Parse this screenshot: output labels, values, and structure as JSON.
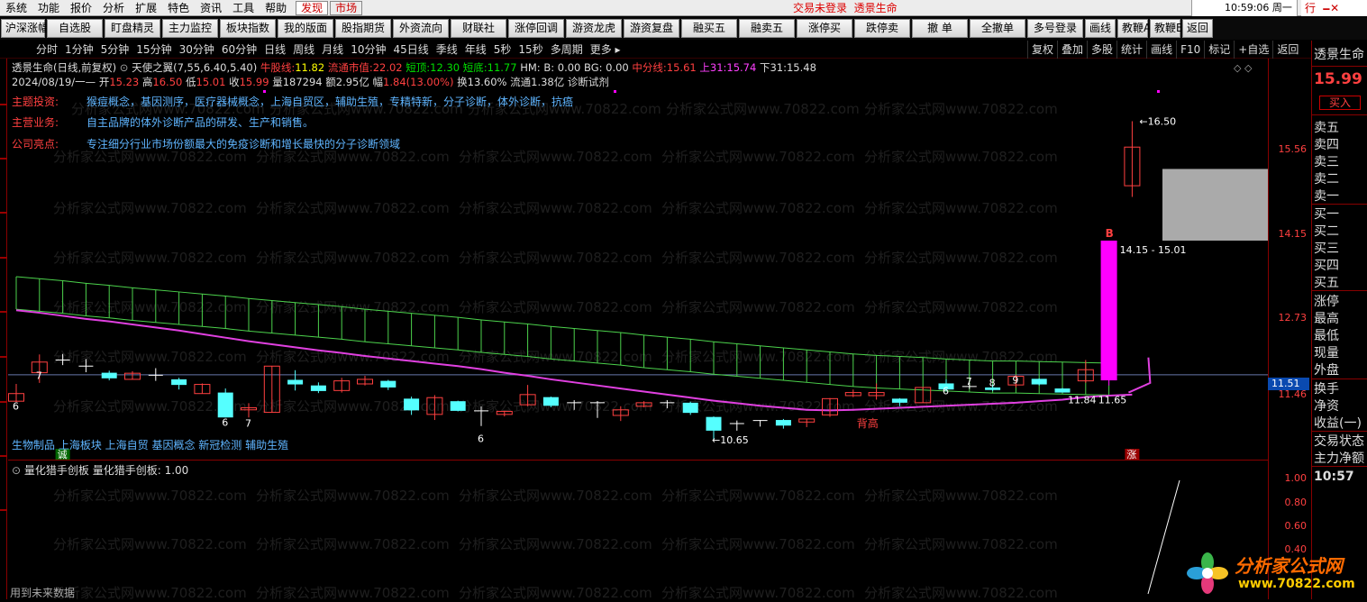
{
  "menubar": {
    "items": [
      "系统",
      "功能",
      "报价",
      "分析",
      "扩展",
      "特色",
      "资讯",
      "工具",
      "帮助"
    ],
    "tab_active": "发现",
    "tab_market": "市场",
    "login_text": "交易未登录",
    "login_stock": "透景生命",
    "clock": "10:59:06 周一",
    "trade": "行"
  },
  "toolbar": {
    "buttons": [
      "沪深涨幅",
      "自选股",
      "盯盘精灵",
      "主力监控",
      "板块指数",
      "我的版面",
      "股指期货",
      "外资流向",
      "财联社",
      "涨停回调",
      "游资龙虎",
      "游资复盘",
      "融买五",
      "融卖五",
      "涨停买",
      "跌停卖",
      "撤 单",
      "全撤单",
      "多号登录",
      "画线",
      "教鞭A",
      "教鞭B",
      "返回"
    ]
  },
  "periodbar": {
    "periods": [
      "分时",
      "1分钟",
      "5分钟",
      "15分钟",
      "30分钟",
      "60分钟",
      "日线",
      "周线",
      "月线",
      "10分钟",
      "45日线",
      "季线",
      "年线",
      "5秒",
      "15秒",
      "多周期",
      "更多"
    ],
    "right_tools": [
      "复权",
      "叠加",
      "多股",
      "统计",
      "画线",
      "F10",
      "标记",
      "+自选",
      "返回"
    ]
  },
  "info": {
    "stock": "透景生命(日线,前复权)",
    "indicator": "天使之翼(7,55,6.40,5.40)",
    "niu_label": "牛股线:",
    "niu_val": "11.82",
    "liutong_label": "流通市值:",
    "liutong_val": "22.02",
    "duanding_label": "短顶:",
    "duanding_val": "12.30",
    "duandi_label": "短底:",
    "duandi_val": "11.77",
    "hm": "HM: B: 0.00",
    "bg": "BG: 0.00",
    "zhongfen_label": "中分线:",
    "zhongfen_val": "15.61",
    "shang_label": "上31:",
    "shang_val": "15.74",
    "xia": "下31:15.48",
    "date": "2024/08/19/一",
    "open_label": "开",
    "open_val": "15.23",
    "high_label": "高",
    "high_val": "16.50",
    "low_label": "低",
    "low_val": "15.01",
    "close_label": "收",
    "close_val": "15.99",
    "vol_label": "量",
    "vol_val": "187294",
    "amt_label": "额",
    "amt_val": "2.95亿",
    "chg_label": "幅",
    "chg_val": "1.84(13.00%)",
    "turn_label": "换",
    "turn_val": "13.60%",
    "flow_label": "流通",
    "flow_val": "1.38亿",
    "tag": "诊断试剂"
  },
  "profile": [
    {
      "key": "主题投资:",
      "value": "猴痘概念，基因测序，医疗器械概念，上海自贸区，辅助生殖，专精特新，分子诊断，体外诊断，抗癌"
    },
    {
      "key": "主营业务:",
      "value": "自主品牌的体外诊断产品的研发、生产和销售。"
    },
    {
      "key": "公司亮点:",
      "value": "专注细分行业市场份额最大的免疫诊断和增长最快的分子诊断领域"
    }
  ],
  "concepts": "生物制品 上海板块 上海自贸 基因概念 新冠检测 辅助生殖",
  "watermark": "分析家公式网www.70822.com",
  "chart_data": {
    "type": "candlestick",
    "ylim": [
      10.0,
      17.2
    ],
    "candles": [
      {
        "o": 10.99,
        "c": 11.14,
        "h": 11.33,
        "l": 10.97
      },
      {
        "o": 11.55,
        "c": 11.76,
        "h": 11.91,
        "l": 11.35
      },
      {
        "o": 11.8,
        "c": 11.8,
        "h": 11.92,
        "l": 11.7
      },
      {
        "o": 11.68,
        "c": 11.68,
        "h": 11.82,
        "l": 11.56
      },
      {
        "o": 11.55,
        "c": 11.44,
        "h": 11.59,
        "l": 11.4
      },
      {
        "o": 11.42,
        "c": 11.54,
        "h": 11.58,
        "l": 11.42
      },
      {
        "o": 11.5,
        "c": 11.5,
        "h": 11.64,
        "l": 11.39
      },
      {
        "o": 11.42,
        "c": 11.31,
        "h": 11.45,
        "l": 11.22
      },
      {
        "o": 11.14,
        "c": 11.32,
        "h": 11.34,
        "l": 11.14
      },
      {
        "o": 11.16,
        "c": 10.67,
        "h": 11.24,
        "l": 10.67
      },
      {
        "o": 10.82,
        "c": 10.86,
        "h": 10.95,
        "l": 10.67
      },
      {
        "o": 10.77,
        "c": 11.68,
        "h": 11.68,
        "l": 10.77
      },
      {
        "o": 11.41,
        "c": 11.32,
        "h": 11.6,
        "l": 11.2
      },
      {
        "o": 11.3,
        "c": 11.19,
        "h": 11.36,
        "l": 11.15
      },
      {
        "o": 11.2,
        "c": 11.39,
        "h": 11.45,
        "l": 11.16
      },
      {
        "o": 11.33,
        "c": 11.42,
        "h": 11.49,
        "l": 11.3
      },
      {
        "o": 11.39,
        "c": 11.26,
        "h": 11.41,
        "l": 11.21
      },
      {
        "o": 11.04,
        "c": 10.81,
        "h": 11.08,
        "l": 10.72
      },
      {
        "o": 10.73,
        "c": 11.06,
        "h": 11.11,
        "l": 10.62
      },
      {
        "o": 10.99,
        "c": 10.8,
        "h": 11.0,
        "l": 10.79
      },
      {
        "o": 10.8,
        "c": 10.8,
        "h": 10.89,
        "l": 10.5
      },
      {
        "o": 10.73,
        "c": 10.79,
        "h": 10.8,
        "l": 10.69
      },
      {
        "o": 10.92,
        "c": 11.12,
        "h": 11.31,
        "l": 10.89
      },
      {
        "o": 11.07,
        "c": 10.9,
        "h": 11.08,
        "l": 10.87
      },
      {
        "o": 10.96,
        "c": 10.96,
        "h": 11.01,
        "l": 10.82
      },
      {
        "o": 10.96,
        "c": 10.96,
        "h": 10.99,
        "l": 10.66
      },
      {
        "o": 10.71,
        "c": 10.82,
        "h": 10.89,
        "l": 10.6
      },
      {
        "o": 10.89,
        "c": 10.96,
        "h": 10.99,
        "l": 10.87
      },
      {
        "o": 10.96,
        "c": 10.96,
        "h": 11.01,
        "l": 10.85
      },
      {
        "o": 10.96,
        "c": 10.76,
        "h": 10.98,
        "l": 10.72
      },
      {
        "o": 10.68,
        "c": 10.41,
        "h": 10.69,
        "l": 10.23
      },
      {
        "o": 10.55,
        "c": 10.55,
        "h": 10.61,
        "l": 10.41
      },
      {
        "o": 10.61,
        "c": 10.61,
        "h": 10.62,
        "l": 10.49
      },
      {
        "o": 10.62,
        "c": 10.51,
        "h": 10.64,
        "l": 10.45
      },
      {
        "o": 10.58,
        "c": 10.64,
        "h": 10.64,
        "l": 10.48
      },
      {
        "o": 10.72,
        "c": 11.04,
        "h": 11.05,
        "l": 10.68
      },
      {
        "o": 11.1,
        "c": 11.16,
        "h": 11.22,
        "l": 11.07
      },
      {
        "o": 11.1,
        "c": 11.16,
        "h": 11.34,
        "l": 11.02
      },
      {
        "o": 11.04,
        "c": 10.96,
        "h": 11.05,
        "l": 10.89
      },
      {
        "o": 10.96,
        "c": 11.26,
        "h": 11.26,
        "l": 10.96
      },
      {
        "o": 11.34,
        "c": 11.22,
        "h": 11.42,
        "l": 11.18
      },
      {
        "o": 11.28,
        "c": 11.28,
        "h": 11.35,
        "l": 11.23
      },
      {
        "o": 11.26,
        "c": 11.21,
        "h": 11.32,
        "l": 11.19
      },
      {
        "o": 11.31,
        "c": 11.48,
        "h": 11.51,
        "l": 11.26
      },
      {
        "o": 11.43,
        "c": 11.32,
        "h": 11.44,
        "l": 11.3
      },
      {
        "o": 11.24,
        "c": 11.16,
        "h": 11.25,
        "l": 11.16
      },
      {
        "o": 11.39,
        "c": 11.61,
        "h": 11.8,
        "l": 11.35
      },
      {
        "o": 11.4,
        "c": 14.15,
        "h": 14.15,
        "l": 11.3
      },
      {
        "o": 15.23,
        "c": 15.99,
        "h": 16.5,
        "l": 15.01
      }
    ],
    "ma": [
      12.78,
      12.73,
      12.67,
      12.61,
      12.56,
      12.5,
      12.44,
      12.38,
      12.31,
      12.24,
      12.17,
      12.11,
      12.05,
      11.99,
      11.94,
      11.88,
      11.83,
      11.78,
      11.73,
      11.68,
      11.62,
      11.55,
      11.49,
      11.42,
      11.36,
      11.3,
      11.24,
      11.18,
      11.12,
      11.06,
      11.0,
      10.95,
      10.9,
      10.86,
      10.82,
      10.81,
      10.82,
      10.84,
      10.86,
      10.88,
      10.9,
      10.92,
      10.94,
      10.96,
      10.99,
      11.02,
      11.07,
      11.1,
      11.12
    ],
    "band_top": [
      13.44,
      13.4,
      13.36,
      13.31,
      13.27,
      13.22,
      13.18,
      13.14,
      13.1,
      13.06,
      13.01,
      12.97,
      12.93,
      12.89,
      12.85,
      12.8,
      12.76,
      12.72,
      12.68,
      12.64,
      12.59,
      12.55,
      12.51,
      12.46,
      12.42,
      12.38,
      12.34,
      12.29,
      12.25,
      12.21,
      12.16,
      12.12,
      12.08,
      12.04,
      12.0,
      11.96,
      11.92,
      11.89,
      11.87,
      11.85,
      11.82,
      11.8,
      11.78,
      11.78,
      11.77,
      11.76,
      11.75,
      11.74
    ],
    "band_bot": [
      12.8,
      12.76,
      12.72,
      12.67,
      12.63,
      12.58,
      12.54,
      12.5,
      12.46,
      12.42,
      12.37,
      12.33,
      12.29,
      12.25,
      12.21,
      12.16,
      12.12,
      12.08,
      12.04,
      12.0,
      11.95,
      11.91,
      11.87,
      11.82,
      11.78,
      11.74,
      11.7,
      11.65,
      11.61,
      11.57,
      11.52,
      11.48,
      11.44,
      11.4,
      11.36,
      11.32,
      11.28,
      11.25,
      11.23,
      11.21,
      11.19,
      11.17,
      11.15,
      11.15,
      11.14,
      11.13,
      11.12,
      11.11
    ],
    "labels": [
      {
        "text": "6",
        "i": 0,
        "v": 10.9
      },
      {
        "text": "7",
        "i": 1,
        "v": 11.5
      },
      {
        "text": "6",
        "i": 9,
        "v": 10.58
      },
      {
        "text": "7",
        "i": 10,
        "v": 10.56
      },
      {
        "text": "6",
        "i": 20,
        "v": 10.26
      },
      {
        "text": "6",
        "i": 40,
        "v": 11.2
      },
      {
        "text": "7",
        "i": 41,
        "v": 11.38
      },
      {
        "text": "8",
        "i": 42,
        "v": 11.36
      },
      {
        "text": "9",
        "i": 43,
        "v": 11.41
      }
    ],
    "annotations": [
      "16.50",
      "14.15 - 15.01",
      "11.84",
      "11.65",
      "←10.65",
      "背高",
      "B"
    ],
    "markers": [
      "诚",
      "涨"
    ],
    "yticks": [
      "15.56",
      "14.15",
      "12.73",
      "11.46"
    ],
    "current_price": "11.51"
  },
  "subchart": {
    "title": "量化猎手创板",
    "value_label": "量化猎手创板: 1.00",
    "yticks": [
      "1.00",
      "0.80",
      "0.60",
      "0.40"
    ],
    "footer": "用到未来数据",
    "time": "10:57"
  },
  "right_panel": {
    "name": "透景生命",
    "price": "15.99",
    "buy_button": "买入",
    "sells": [
      "卖五",
      "卖四",
      "卖三",
      "卖二",
      "卖一"
    ],
    "buys": [
      "买一",
      "买二",
      "买三",
      "买四",
      "买五"
    ],
    "stats": [
      "涨停",
      "最高",
      "最低",
      "现量",
      "外盘"
    ],
    "stats2": [
      "换手",
      "净资",
      "收益(一)"
    ],
    "more": [
      "交易状态",
      "主力净额"
    ]
  },
  "logo": {
    "text": "分析家公式网",
    "url": "www.70822.com"
  }
}
